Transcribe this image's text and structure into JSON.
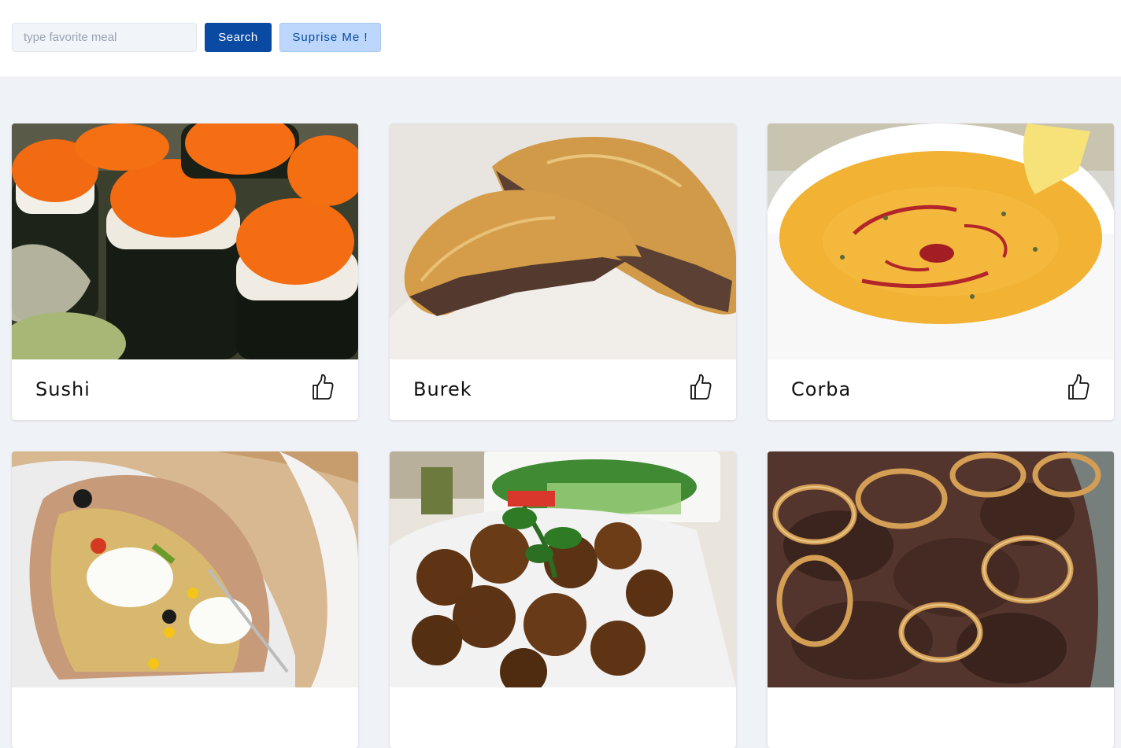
{
  "search": {
    "placeholder": "type favorite meal",
    "value": "",
    "search_label": "Search",
    "surprise_label": "Suprise Me !"
  },
  "colors": {
    "primary": "#0b4aa2",
    "secondary_bg": "#bcd7fb",
    "page_bg": "#eff2f7"
  },
  "meals": [
    {
      "title": "Sushi",
      "image": "sushi-photo",
      "icon": "thumbs-up-icon"
    },
    {
      "title": "Burek",
      "image": "burek-photo",
      "icon": "thumbs-up-icon"
    },
    {
      "title": "Corba",
      "image": "corba-soup-photo",
      "icon": "thumbs-up-icon"
    },
    {
      "title": "",
      "image": "stuffed-baked-potato-photo",
      "icon": "thumbs-up-icon"
    },
    {
      "title": "",
      "image": "falafel-photo",
      "icon": "thumbs-up-icon"
    },
    {
      "title": "",
      "image": "liver-and-onions-photo",
      "icon": "thumbs-up-icon"
    }
  ]
}
